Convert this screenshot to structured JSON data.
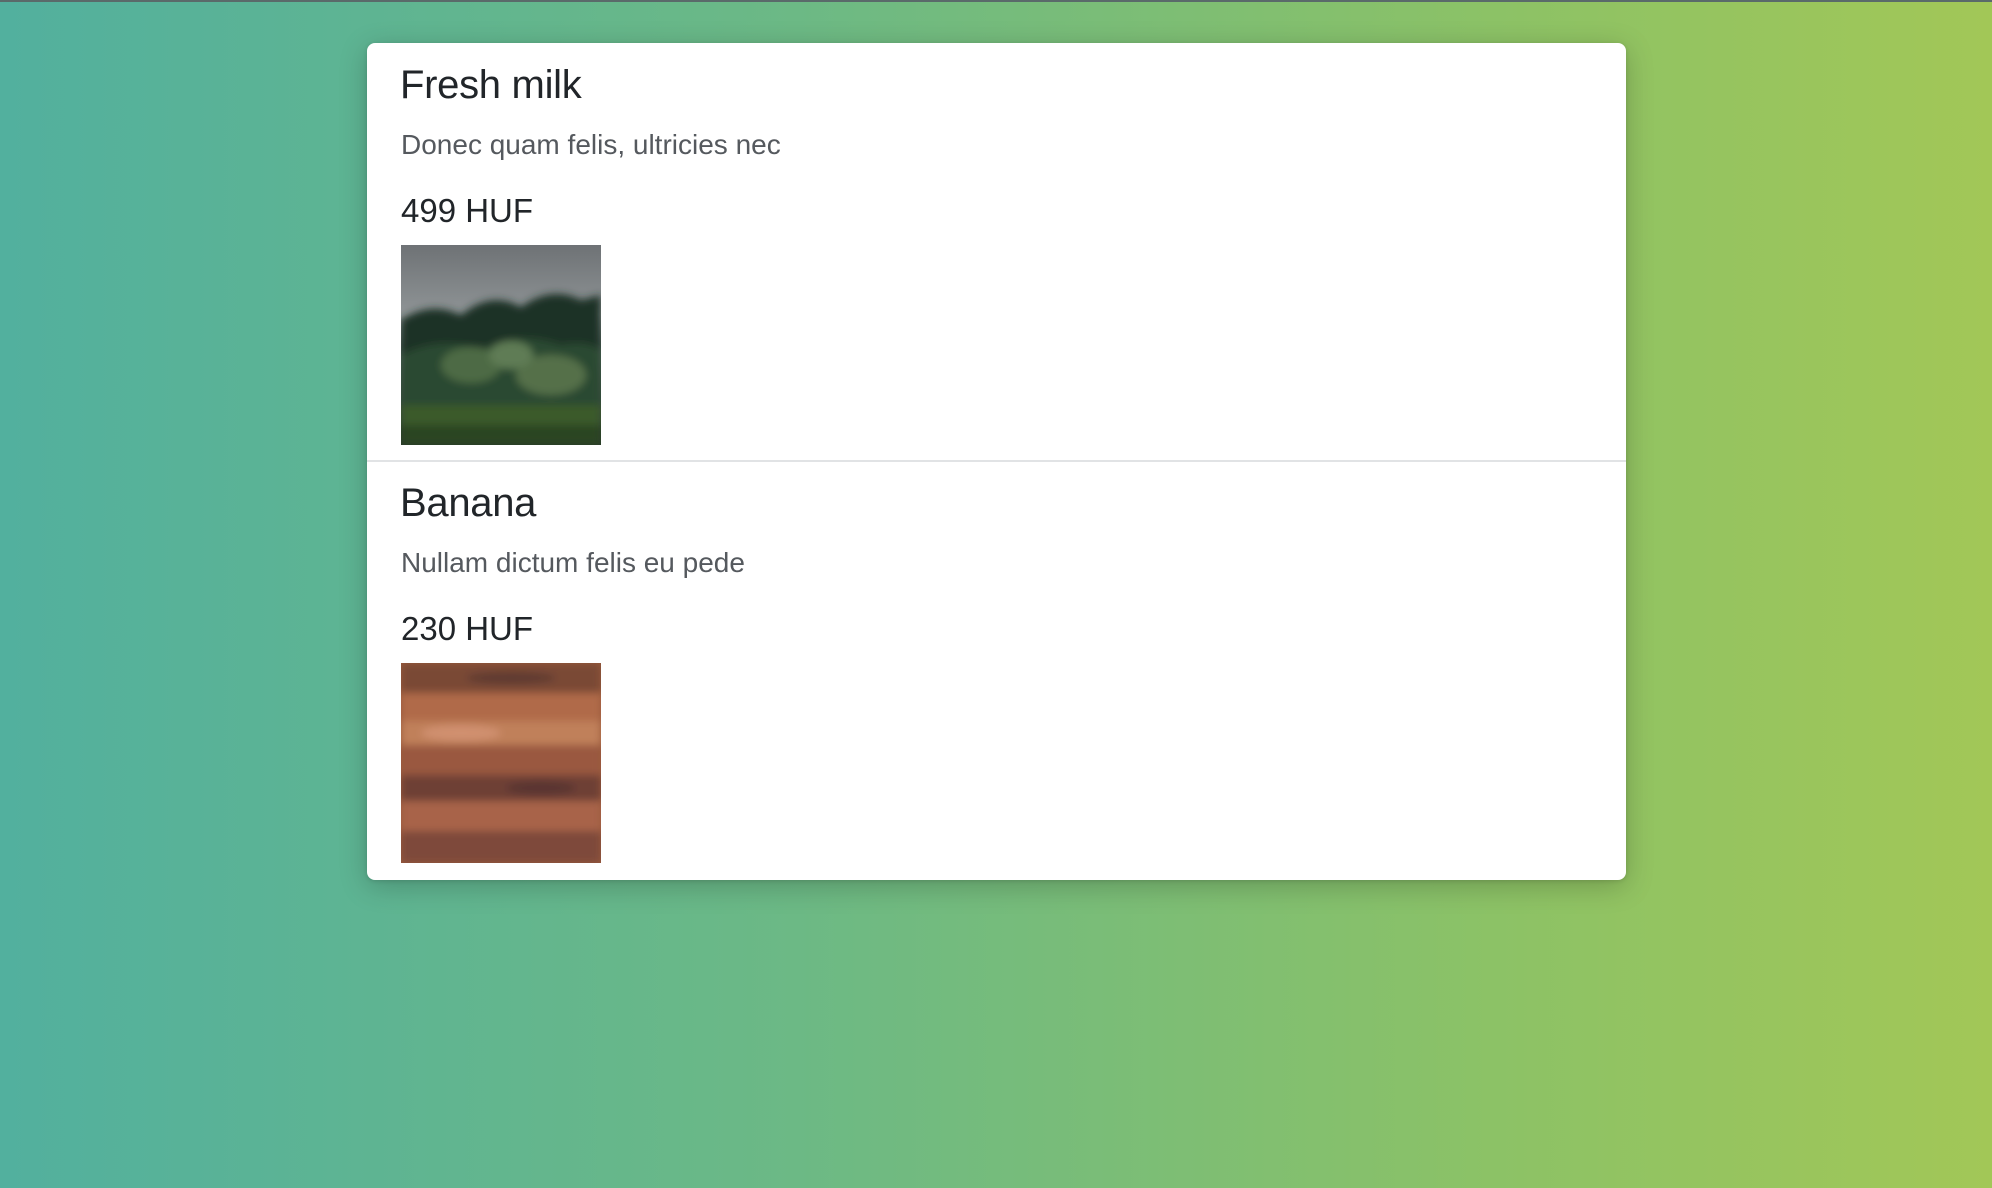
{
  "products": [
    {
      "name": "Fresh milk",
      "description": "Donec quam felis, ultricies nec",
      "price": "499 HUF",
      "image": "forest-hillside-photo"
    },
    {
      "name": "Banana",
      "description": "Nullam dictum felis eu pede",
      "price": "230 HUF",
      "image": "wood-texture-photo"
    }
  ],
  "colors": {
    "background_gradient_start": "#52b09e",
    "background_gradient_end": "#a2c757",
    "card_background": "#ffffff",
    "title_text": "#212529",
    "description_text": "#55595e",
    "divider": "#e1e3e5"
  }
}
